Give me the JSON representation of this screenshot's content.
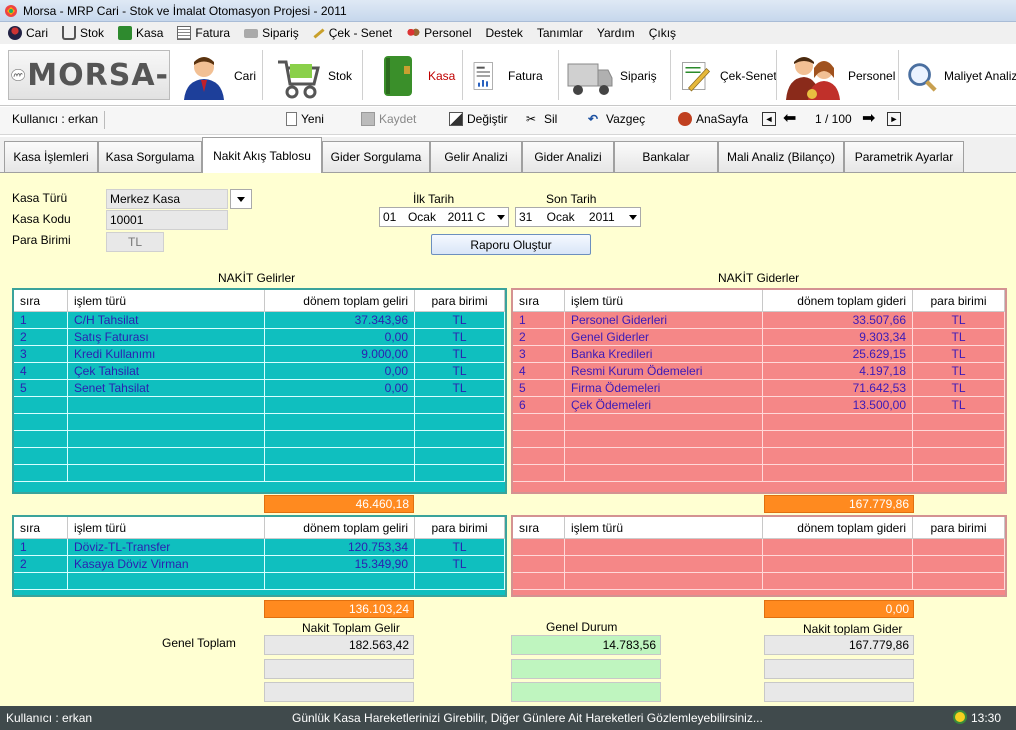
{
  "window": {
    "title": "Morsa - MRP Cari - Stok ve İmalat Otomasyon Projesi  -  2011"
  },
  "menu": [
    "Cari",
    "Stok",
    "Kasa",
    "Fatura",
    "Sipariş",
    "Çek - Senet",
    "Personel",
    "Destek",
    "Tanımlar",
    "Yardım",
    "Çıkış"
  ],
  "brand": {
    "logo_text": "MORSA-"
  },
  "bigtoolbar": {
    "cari": "Cari",
    "stok": "Stok",
    "kasa": "Kasa",
    "fatura": "Fatura",
    "siparis": "Sipariş",
    "cek_senet": "Çek-Senet",
    "personel": "Personel",
    "maliyet": "Maliyet Analizi"
  },
  "smalltoolbar": {
    "user": "Kullanıcı : erkan",
    "yeni": "Yeni",
    "kaydet": "Kaydet",
    "degistir": "Değiştir",
    "sil": "Sil",
    "vazgec": "Vazgeç",
    "anasayfa": "AnaSayfa",
    "page": "1 / 100"
  },
  "tabs": [
    "Kasa İşlemleri",
    "Kasa Sorgulama",
    "Nakit Akış Tablosu",
    "Gider Sorgulama",
    "Gelir  Analizi",
    "Gider Analizi",
    "Bankalar",
    "Mali Analiz (Bilanço)",
    "Parametrik Ayarlar"
  ],
  "filters": {
    "kasa_turu_label": "Kasa Türü",
    "kasa_turu": "Merkez Kasa",
    "kasa_kodu_label": "Kasa Kodu",
    "kasa_kodu": "10001",
    "para_birimi_label": "Para Birimi",
    "para_birimi": "TL",
    "ilk_tarih_label": "İlk Tarih",
    "ilk_gun": "01",
    "ilk_ay": "Ocak",
    "ilk_yil": "2011 C",
    "son_tarih_label": "Son Tarih",
    "son_gun": "31",
    "son_ay": "Ocak",
    "son_yil": "2011",
    "rapor_button": "Raporu Oluştur"
  },
  "income": {
    "title": "NAKİT Gelirler",
    "headers": [
      "sıra",
      "işlem türü",
      "dönem toplam geliri",
      "para birimi"
    ],
    "rows": [
      [
        "1",
        "C/H Tahsilat",
        "37.343,96",
        "TL"
      ],
      [
        "2",
        "Satış Faturası",
        "0,00",
        "TL"
      ],
      [
        "3",
        "Kredi Kullanımı",
        "9.000,00",
        "TL"
      ],
      [
        "4",
        "Çek Tahsilat",
        "0,00",
        "TL"
      ],
      [
        "5",
        "Senet Tahsilat",
        "0,00",
        "TL"
      ]
    ],
    "total": "46.460,18",
    "headers2": [
      "sıra",
      "işlem türü",
      "dönem toplam geliri",
      "para birimi"
    ],
    "rows2": [
      [
        "1",
        "Döviz-TL-Transfer",
        "120.753,34",
        "TL"
      ],
      [
        "2",
        "Kasaya Döviz Virman",
        "15.349,90",
        "TL"
      ]
    ],
    "total2": "136.103,24"
  },
  "expense": {
    "title": "NAKİT Giderler",
    "headers": [
      "sıra",
      "işlem türü",
      "dönem toplam gideri",
      "para birimi"
    ],
    "rows": [
      [
        "1",
        "Personel Giderleri",
        "33.507,66",
        "TL"
      ],
      [
        "2",
        "Genel Giderler",
        "9.303,34",
        "TL"
      ],
      [
        "3",
        "Banka Kredileri",
        "25.629,15",
        "TL"
      ],
      [
        "4",
        "Resmi Kurum Ödemeleri",
        "4.197,18",
        "TL"
      ],
      [
        "5",
        "Firma Ödemeleri",
        "71.642,53",
        "TL"
      ],
      [
        "6",
        "Çek Ödemeleri",
        "13.500,00",
        "TL"
      ]
    ],
    "total": "167.779,86",
    "headers2": [
      "sıra",
      "işlem türü",
      "dönem toplam gideri",
      "para birimi"
    ],
    "total2": "0,00"
  },
  "summary": {
    "genel_toplam_label": "Genel Toplam",
    "nakit_gelir_label": "Nakit Toplam Gelir",
    "nakit_gelir": "182.563,42",
    "genel_durum_label": "Genel Durum",
    "genel_durum": "14.783,56",
    "nakit_gider_label": "Nakit toplam Gider",
    "nakit_gider": "167.779,86"
  },
  "status": {
    "user": "Kullanıcı : erkan",
    "message": "Günlük Kasa Hareketlerinizi Girebilir, Diğer Günlere Ait Hareketleri Gözlemleyebilirsiniz...",
    "time": "13:30"
  }
}
